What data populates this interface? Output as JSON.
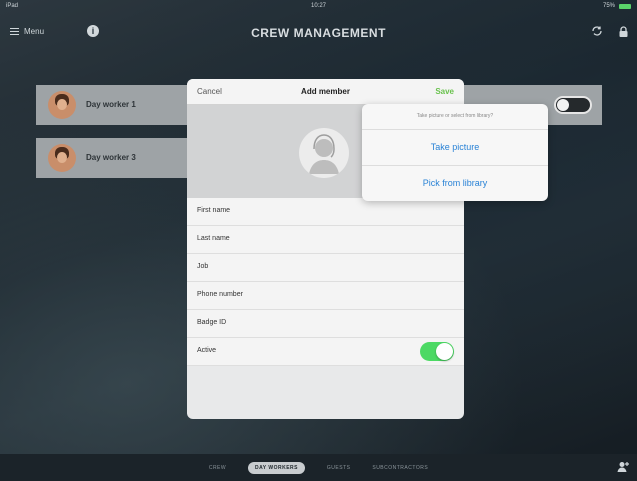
{
  "status_bar": {
    "carrier": "iPad",
    "time": "10:27",
    "battery": "75%"
  },
  "nav": {
    "menu_label": "Menu",
    "info_label": "i",
    "title": "CREW MANAGEMENT"
  },
  "list": [
    {
      "name": "Day worker 1"
    },
    {
      "name": "Day worker 3"
    }
  ],
  "modal": {
    "cancel": "Cancel",
    "title": "Add member",
    "save": "Save",
    "fields": [
      "First name",
      "Last name",
      "Job",
      "Phone number",
      "Badge ID"
    ],
    "active_label": "Active",
    "active_on": true
  },
  "popover": {
    "prompt": "Take picture or select from library?",
    "take_picture": "Take picture",
    "pick_library": "Pick from library"
  },
  "tabs": {
    "crew": "CREW",
    "day_workers": "DAY WORKERS",
    "guests": "GUESTS",
    "subcontractors": "SUBCONTRACTORS"
  },
  "colors": {
    "accent_green": "#4cd964",
    "link_blue": "#2a83d6",
    "save_green": "#6ac24e"
  },
  "icons": [
    "menu-icon",
    "info-icon",
    "sync-icon",
    "lock-icon",
    "add-person-icon",
    "avatar-placeholder-icon"
  ]
}
